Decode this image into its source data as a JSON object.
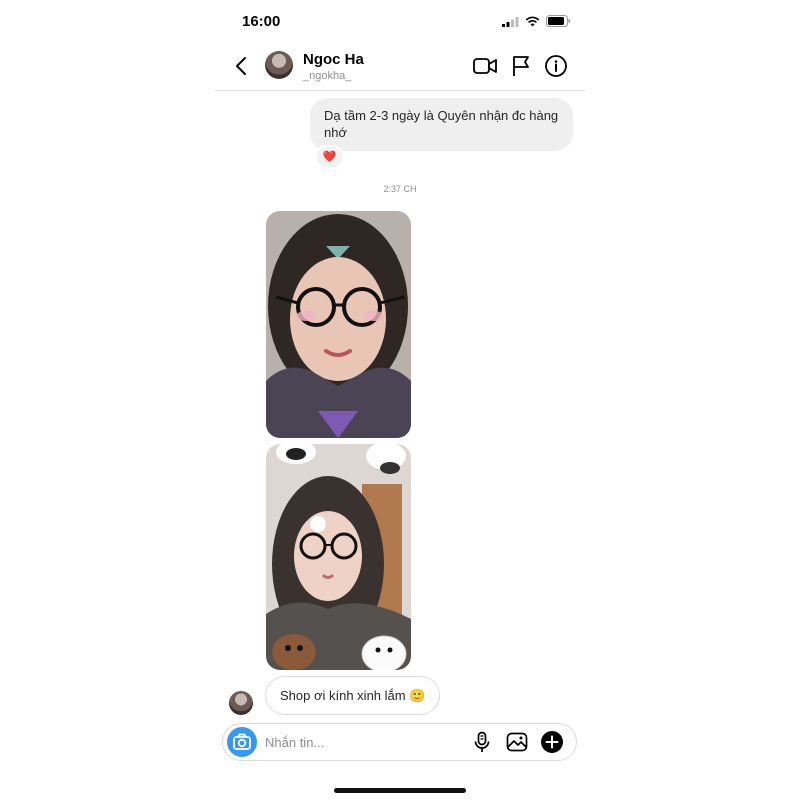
{
  "status_bar": {
    "time": "16:00"
  },
  "header": {
    "name": "Ngoc Ha",
    "handle": "_ngokha_"
  },
  "messages": {
    "outgoing_text": "Dạ tầm 2-3 ngày là Quyên nhận đc hàng nhớ",
    "reaction": "❤️",
    "timestamp": "2:37 CH",
    "incoming_text": "Shop ơi kính xinh lắm 🙂"
  },
  "composer": {
    "placeholder": "Nhắn tin..."
  },
  "colors": {
    "accent_blue": "#3897f0",
    "bubble_grey": "#efefef",
    "secondary_text": "#8e8e8e"
  },
  "icons": {
    "back": "chevron-left-icon",
    "video": "video-call-icon",
    "flag": "flag-icon",
    "info": "info-icon",
    "camera": "camera-icon",
    "mic": "microphone-icon",
    "gallery": "gallery-icon",
    "add": "plus-circle-icon"
  }
}
